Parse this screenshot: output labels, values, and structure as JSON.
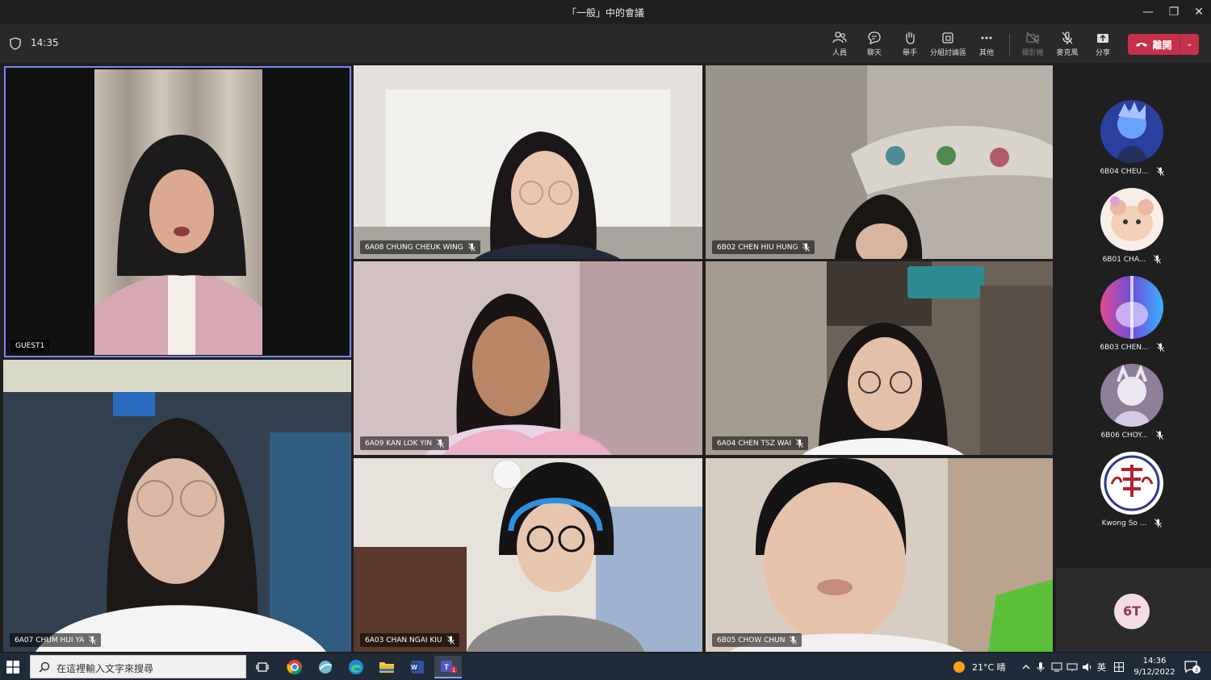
{
  "window": {
    "title": "「一般」中的會議"
  },
  "toolbar": {
    "time": "14:35",
    "buttons": [
      {
        "label": "人員",
        "icon": "people-icon"
      },
      {
        "label": "聊天",
        "icon": "chat-icon"
      },
      {
        "label": "舉手",
        "icon": "raise-hand-icon"
      },
      {
        "label": "分組討論區",
        "icon": "breakout-rooms-icon"
      },
      {
        "label": "其他",
        "icon": "more-icon"
      },
      {
        "label": "攝影機",
        "icon": "camera-off-icon"
      },
      {
        "label": "麥克風",
        "icon": "mic-off-icon"
      },
      {
        "label": "分享",
        "icon": "share-icon"
      }
    ],
    "leave_label": "離開"
  },
  "tiles": [
    {
      "name": "GUEST1",
      "muted": false,
      "active": true
    },
    {
      "name": "6A08 CHUNG CHEUK WING",
      "muted": true
    },
    {
      "name": "6B02 CHEN HIU HUNG",
      "muted": true
    },
    {
      "name": "6A09 KAN LOK YIN",
      "muted": true
    },
    {
      "name": "6A04 CHEN TSZ WAI",
      "muted": true
    },
    {
      "name": "6A07 CHUM HUI YA",
      "muted": true
    },
    {
      "name": "6A03 CHAN NGAI KIU",
      "muted": true
    },
    {
      "name": "6B05 CHOW CHUN",
      "muted": true
    }
  ],
  "side_gallery": [
    {
      "name": "6B04 CHEU...",
      "muted": true
    },
    {
      "name": "6B01 CHA...",
      "muted": true
    },
    {
      "name": "6B03 CHEN...",
      "muted": true
    },
    {
      "name": "6B06 CHOY...",
      "muted": true
    },
    {
      "name": "Kwong So ...",
      "muted": true
    }
  ],
  "self_view": {
    "initials": "6T"
  },
  "taskbar": {
    "search_placeholder": "在這裡輸入文字來搜尋",
    "weather": "21°C 晴",
    "ime": "英",
    "time": "14:36",
    "date": "9/12/2022",
    "notification_count": "3",
    "teams_badge": "1"
  }
}
